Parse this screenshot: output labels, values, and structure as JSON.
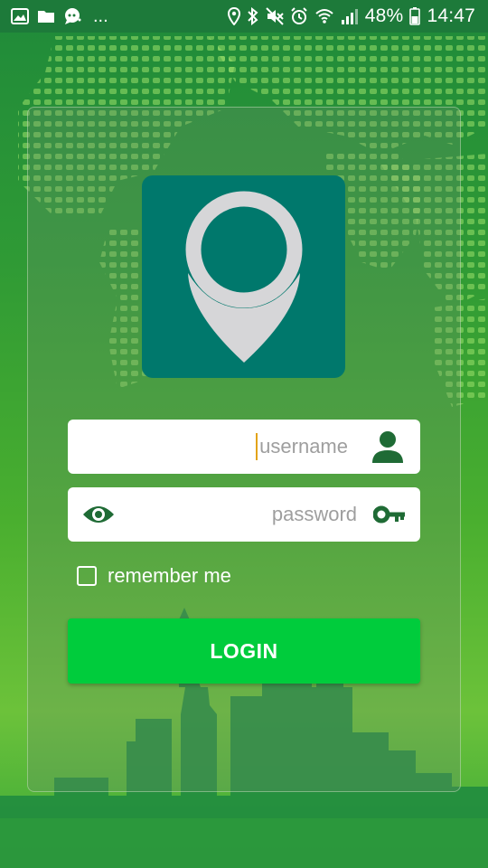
{
  "status_bar": {
    "overflow_dots": "...",
    "battery_percent": "48%",
    "time": "14:47",
    "left_icons": [
      "gallery-icon",
      "folder-icon",
      "chat-icon"
    ],
    "right_icons": [
      "location-icon",
      "bluetooth-icon",
      "mute-icon",
      "alarm-icon",
      "wifi-icon",
      "signal-icon",
      "battery-icon"
    ]
  },
  "login": {
    "logo_icon": "map-pin-icon",
    "username_placeholder": "username",
    "password_placeholder": "password",
    "remember_label": "remember me",
    "remember_checked": false,
    "login_label": "LOGIN"
  },
  "colors": {
    "status_bar": "#1d7a3a",
    "logo_bg": "#00786c",
    "field_icon": "#1f6b35",
    "login_button": "#00cc3c",
    "caret": "#e2a317"
  }
}
